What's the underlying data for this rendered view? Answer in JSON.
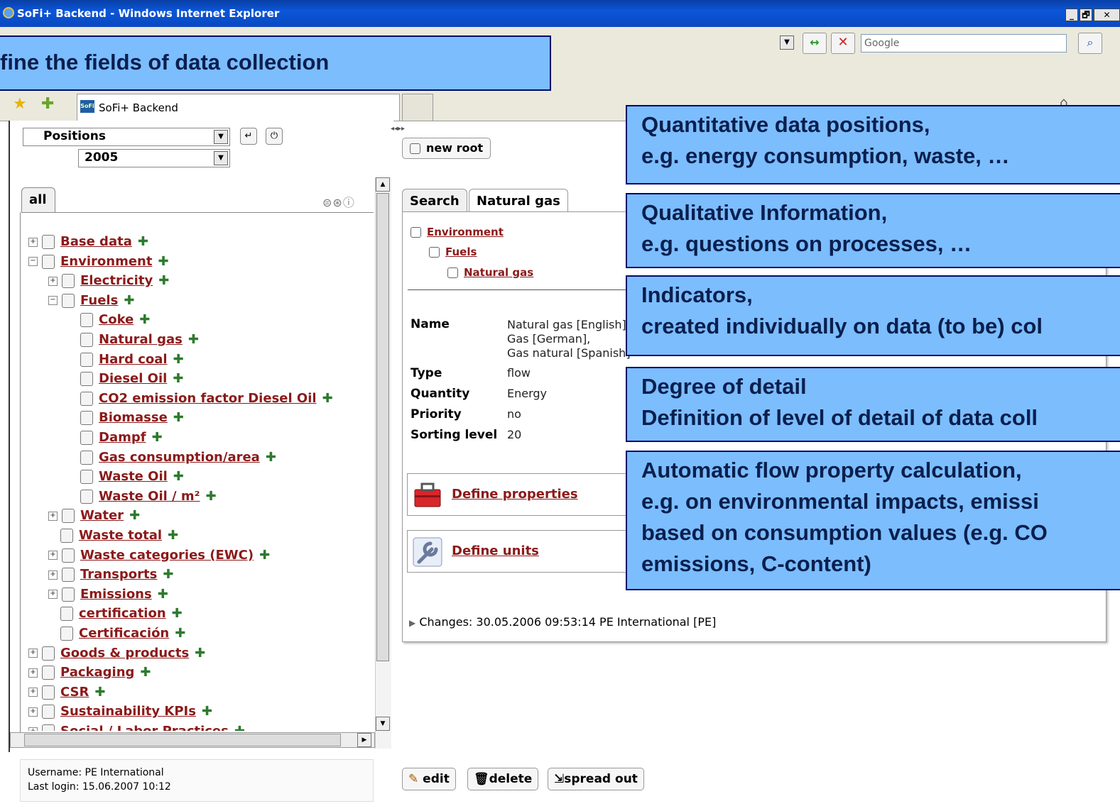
{
  "window": {
    "title": "SoFi+ Backend - Windows Internet Explorer",
    "min": "_",
    "max": "🗗",
    "close": "✕"
  },
  "browser": {
    "search_placeholder": "Google",
    "tab_title": "SoFi+ Backend",
    "favicon_text": "SoFi"
  },
  "callouts": {
    "top": "fine the fields of data collection",
    "quantitative": [
      "Quantitative data positions,",
      "e.g. energy consumption, waste, …"
    ],
    "qualitative": [
      "Qualitative Information,",
      "e.g. questions on processes, …"
    ],
    "indicators": [
      "Indicators,",
      "created individually on data (to be) col"
    ],
    "degree": [
      "Degree of detail",
      "Definition of level of detail of data coll"
    ],
    "automatic": [
      "Automatic flow property calculation,",
      "e.g. on environmental impacts, emissi",
      "based on consumption values (e.g. CO",
      "emissions, C-content)"
    ]
  },
  "filters": {
    "positions_label": "Positions",
    "year": "2005"
  },
  "tree_tab": "all",
  "tree": [
    {
      "label": "Base data",
      "indent": 0,
      "toggle": "+"
    },
    {
      "label": "Environment",
      "indent": 0,
      "toggle": "−"
    },
    {
      "label": "Electricity",
      "indent": 1,
      "toggle": "+"
    },
    {
      "label": "Fuels",
      "indent": 1,
      "toggle": "−"
    },
    {
      "label": "Coke",
      "indent": 2,
      "toggle": ""
    },
    {
      "label": "Natural gas",
      "indent": 2,
      "toggle": ""
    },
    {
      "label": "Hard coal",
      "indent": 2,
      "toggle": ""
    },
    {
      "label": "Diesel Oil",
      "indent": 2,
      "toggle": ""
    },
    {
      "label": "CO2 emission factor Diesel Oil",
      "indent": 2,
      "toggle": ""
    },
    {
      "label": "Biomasse",
      "indent": 2,
      "toggle": ""
    },
    {
      "label": "Dampf",
      "indent": 2,
      "toggle": ""
    },
    {
      "label": "Gas consumption/area",
      "indent": 2,
      "toggle": ""
    },
    {
      "label": "Waste Oil",
      "indent": 2,
      "toggle": ""
    },
    {
      "label": "Waste Oil / m²",
      "indent": 2,
      "toggle": ""
    },
    {
      "label": "Water",
      "indent": 1,
      "toggle": "+"
    },
    {
      "label": "Waste total",
      "indent": 1,
      "toggle": ""
    },
    {
      "label": "Waste categories (EWC)",
      "indent": 1,
      "toggle": "+"
    },
    {
      "label": "Transports",
      "indent": 1,
      "toggle": "+"
    },
    {
      "label": "Emissions",
      "indent": 1,
      "toggle": "+"
    },
    {
      "label": "certification",
      "indent": 1,
      "toggle": ""
    },
    {
      "label": "Certificación",
      "indent": 1,
      "toggle": ""
    },
    {
      "label": "Goods & products",
      "indent": 0,
      "toggle": "+"
    },
    {
      "label": "Packaging",
      "indent": 0,
      "toggle": "+"
    },
    {
      "label": "CSR",
      "indent": 0,
      "toggle": "+"
    },
    {
      "label": "Sustainability KPIs",
      "indent": 0,
      "toggle": "+"
    },
    {
      "label": "Social / Labor Practices",
      "indent": 0,
      "toggle": "+"
    }
  ],
  "new_root": "new root",
  "content_tabs": [
    "Search",
    "Natural gas"
  ],
  "breadcrumb": [
    "Environment",
    "Fuels",
    "Natural gas"
  ],
  "properties": {
    "name_label": "Name",
    "name_value": [
      "Natural gas [English],",
      "Gas [German],",
      "Gas natural [Spanish]"
    ],
    "type_label": "Type",
    "type_value": "flow",
    "quantity_label": "Quantity",
    "quantity_value": "Energy",
    "priority_label": "Priority",
    "priority_value": "no",
    "sorting_label": "Sorting level",
    "sorting_value": "20"
  },
  "define_properties": "Define properties",
  "define_units": "Define units",
  "changes": "Changes: 30.05.2006 09:53:14 PE International [PE]",
  "status": {
    "username": "Username: PE International",
    "last_login": "Last login: 15.06.2007 10:12"
  },
  "actions": {
    "edit": "edit",
    "delete": "delete",
    "spread_out": "spread out"
  }
}
